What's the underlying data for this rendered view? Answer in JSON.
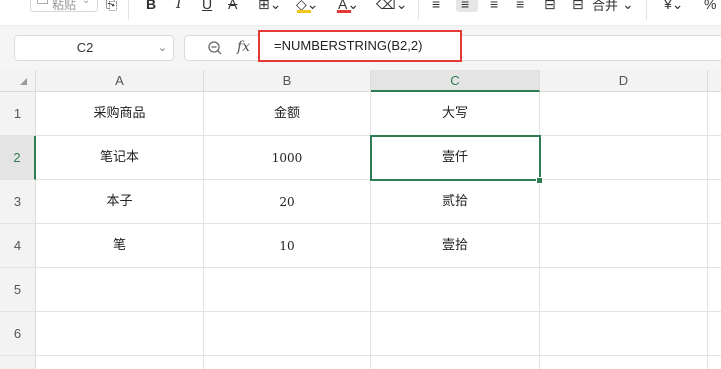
{
  "ribbon": {
    "paste_label": "粘贴",
    "merge_label": "合并",
    "icons": [
      "paste-icon",
      "format-painter-icon",
      "bold-icon",
      "italic-icon",
      "underline-icon",
      "strikethrough-icon",
      "border-icon",
      "fill-color-icon",
      "font-color-icon",
      "clear-icon",
      "align-left-icon",
      "align-center-icon",
      "align-right-icon",
      "wrap-icon",
      "merge-icon",
      "number-format-icon",
      "percent-icon"
    ],
    "accent_red": "#e53935",
    "accent_yellow": "#f5c518"
  },
  "formula_bar": {
    "name_box": "C2",
    "fx_label": "fx",
    "formula": "=NUMBERSTRING(B2,2)"
  },
  "sheet": {
    "columns": [
      "A",
      "B",
      "C",
      "D"
    ],
    "rows": [
      "1",
      "2",
      "3",
      "4",
      "5",
      "6"
    ],
    "cells": [
      [
        "采购商品",
        "金额",
        "大写",
        ""
      ],
      [
        "笔记本",
        "1000",
        "壹仟",
        ""
      ],
      [
        "本子",
        "20",
        "贰拾",
        ""
      ],
      [
        "笔",
        "10",
        "壹拾",
        ""
      ],
      [
        "",
        "",
        "",
        ""
      ],
      [
        "",
        "",
        "",
        ""
      ]
    ],
    "active_cell": "C2",
    "selection_color": "#2e7d52"
  }
}
